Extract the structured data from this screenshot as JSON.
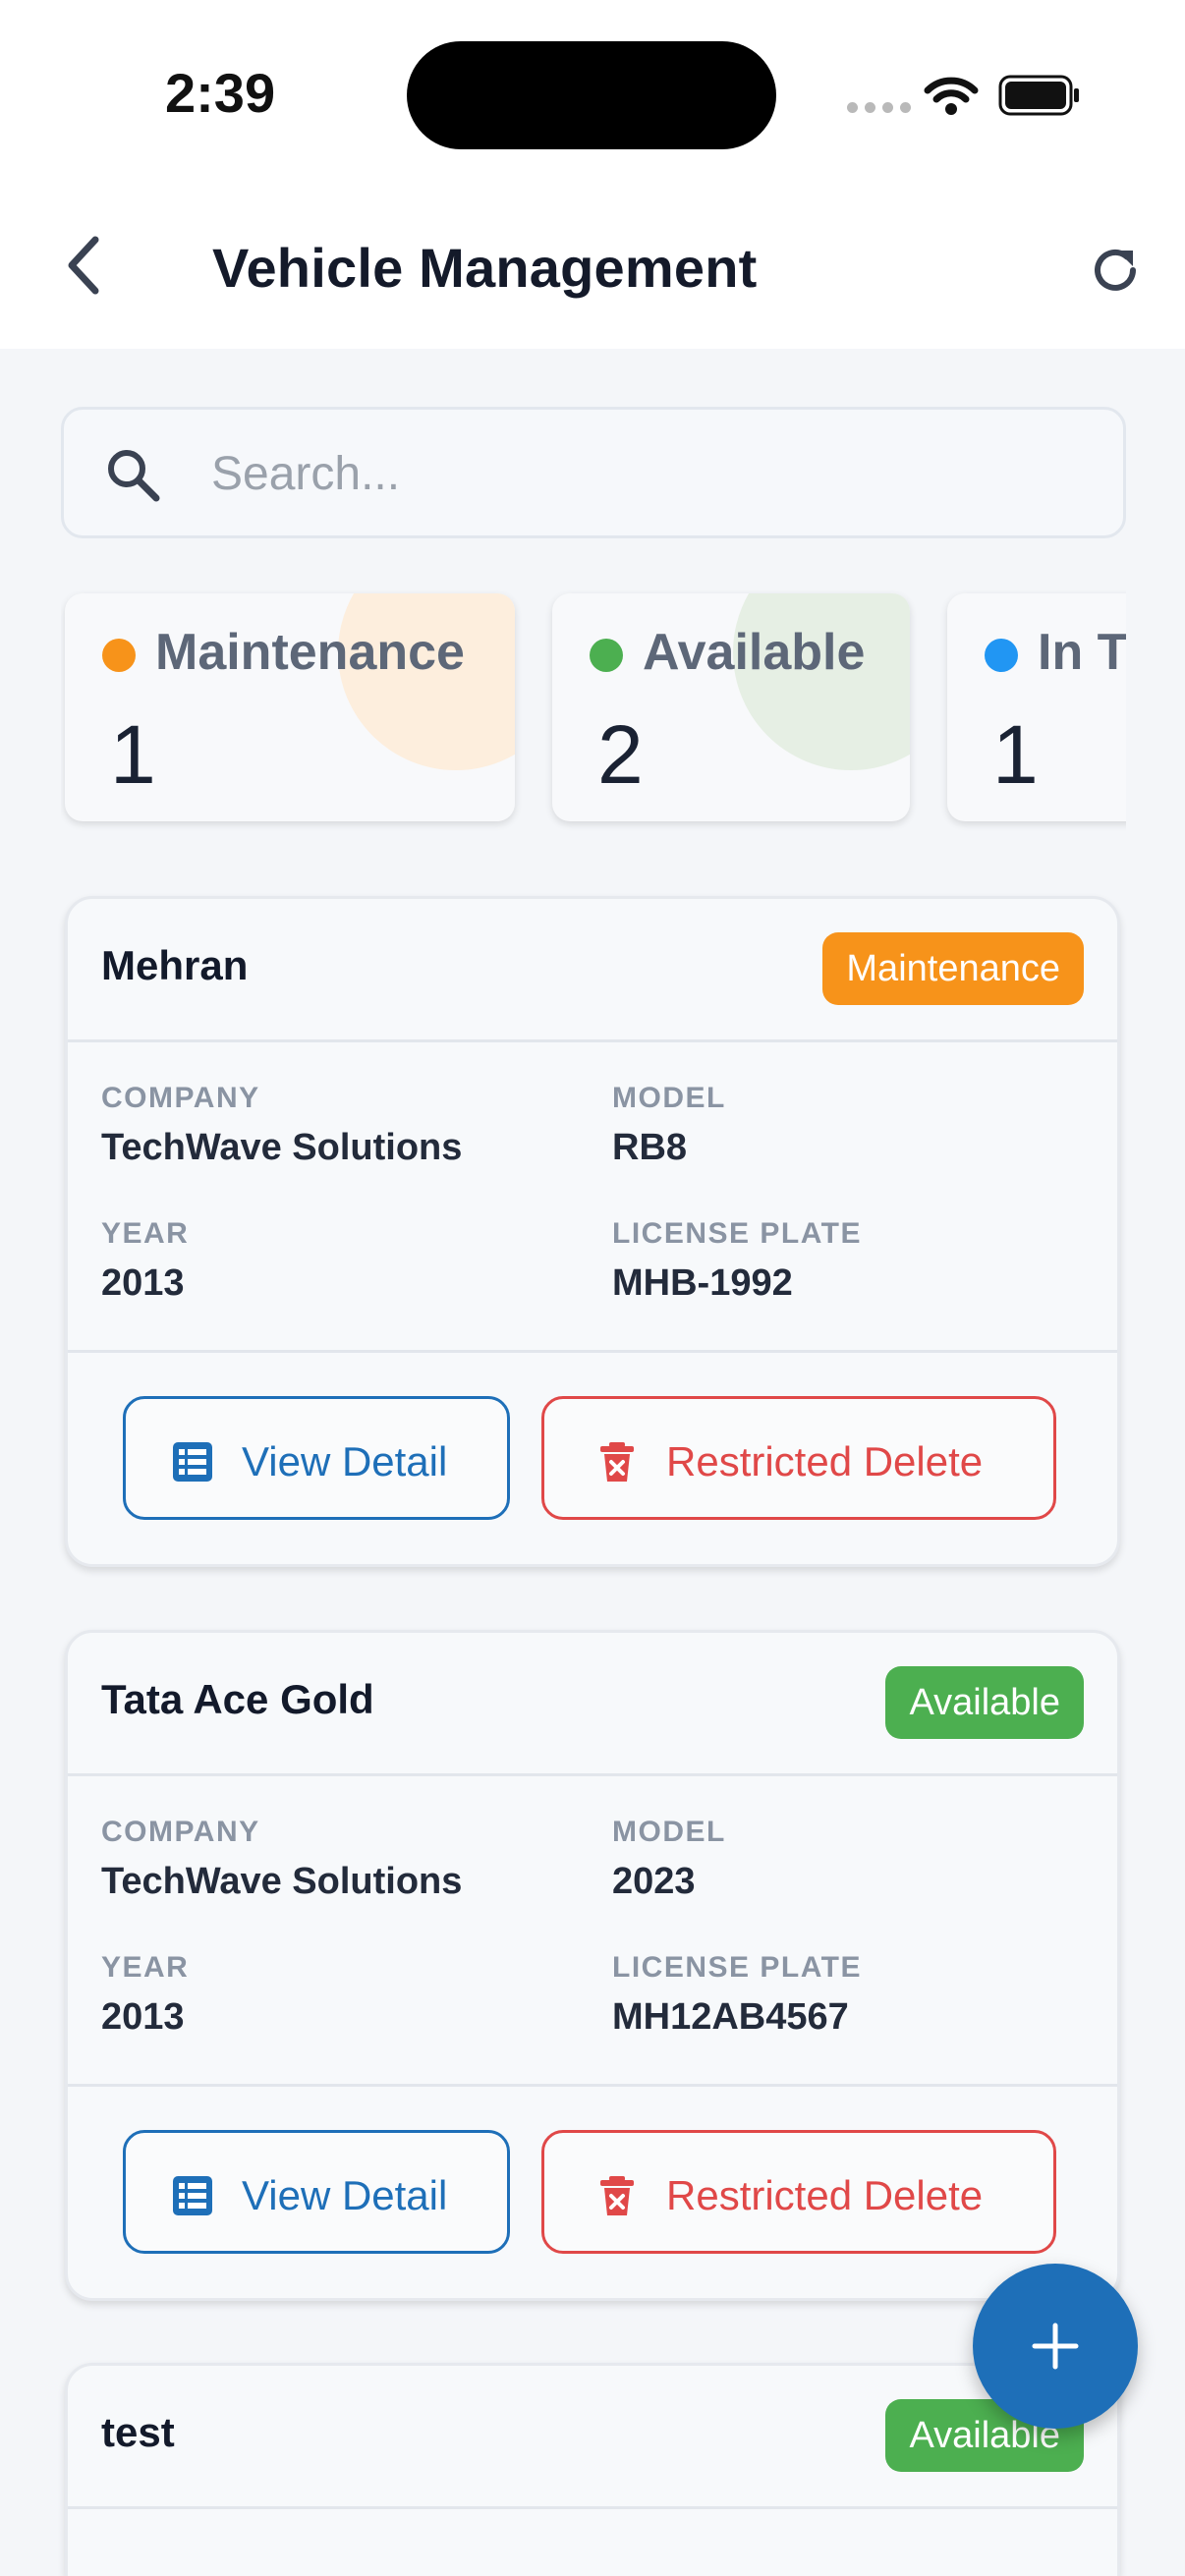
{
  "status_bar": {
    "time": "2:39"
  },
  "header": {
    "title": "Vehicle Management"
  },
  "search": {
    "placeholder": "Search..."
  },
  "stats": [
    {
      "label": "Maintenance",
      "count": "1",
      "color": "#f7931a"
    },
    {
      "label": "Available",
      "count": "2",
      "color": "#4caf50"
    },
    {
      "label": "In T",
      "count": "1",
      "color": "#2196f3"
    }
  ],
  "field_labels": {
    "company": "COMPANY",
    "model": "MODEL",
    "year": "YEAR",
    "license_plate": "LICENSE PLATE"
  },
  "actions": {
    "view": "View Detail",
    "delete": "Restricted Delete"
  },
  "vehicles": [
    {
      "name": "Mehran",
      "status": "Maintenance",
      "status_color": "#f7931a",
      "company": "TechWave Solutions",
      "model": "RB8",
      "year": "2013",
      "license_plate": "MHB-1992"
    },
    {
      "name": "Tata Ace Gold",
      "status": "Available",
      "status_color": "#4caf50",
      "company": "TechWave Solutions",
      "model": "2023",
      "year": "2013",
      "license_plate": "MH12AB4567"
    },
    {
      "name": "test",
      "status": "Available",
      "status_color": "#4caf50"
    }
  ],
  "colors": {
    "primary": "#1e6fb8",
    "danger": "#e04848"
  }
}
